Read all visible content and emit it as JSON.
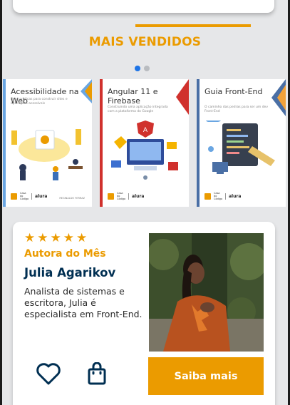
{
  "section": {
    "title": "MAIS VENDIDOS"
  },
  "carousel": {
    "pages": 2,
    "active_index": 0,
    "books": [
      {
        "title": "Acessibilidade na Web",
        "subtitle": "Boas práticas para construir sites e aplicações acessíveis",
        "author": "REGINALDO FERRAZ",
        "publisher": "Casa do Código",
        "brand": "alura",
        "stripe_color": "#6aa6e2",
        "accent_color": "#eb9b00"
      },
      {
        "title": "Angular 11 e Firebase",
        "subtitle": "Construindo uma aplicação integrada com a plataforma do Google",
        "author": "",
        "publisher": "Casa do Código",
        "brand": "alura",
        "stripe_color": "#d0312d",
        "accent_color": "#d0312d"
      },
      {
        "title": "Guia Front-End",
        "subtitle": "O caminho das pedras para ser um dev Front-End",
        "author": "",
        "publisher": "Casa do Código",
        "brand": "alura",
        "stripe_color": "#4a6fa5",
        "accent_color": "#4a6fa5"
      }
    ]
  },
  "author_card": {
    "rating": 5,
    "label": "Autora do Mês",
    "name": "Julia Agarikov",
    "bio": "Analista de sistemas e escritora, Julia é especialista em Front-End.",
    "cta_label": "Saiba mais",
    "icons": [
      "heart-icon",
      "shopping-bag-icon"
    ]
  },
  "colors": {
    "accent": "#eb9b00",
    "navy": "#002f52",
    "background": "#e6e7e9"
  }
}
